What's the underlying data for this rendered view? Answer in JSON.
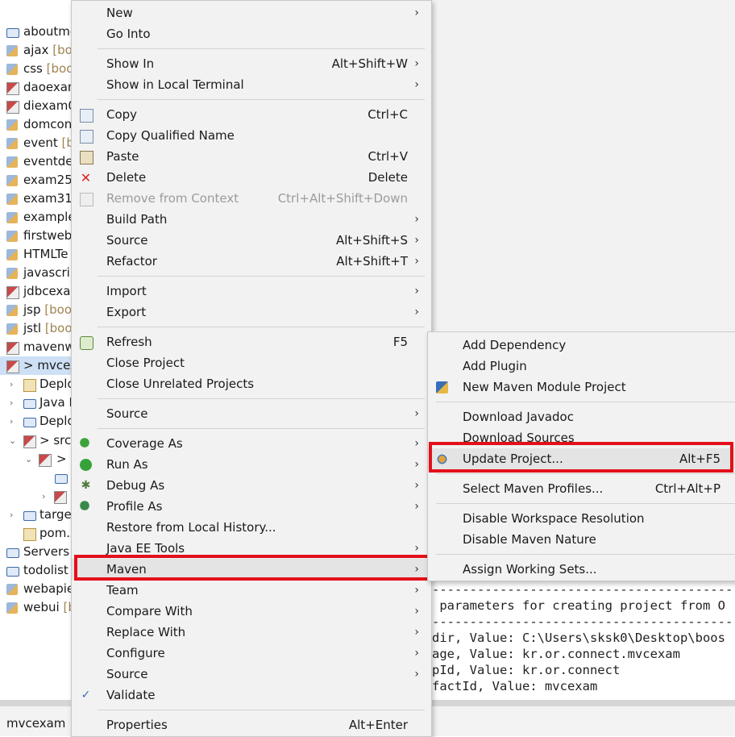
{
  "explorer": {
    "items": [
      {
        "label": "aboutme",
        "decoration": "",
        "icon": "folder-icon"
      },
      {
        "label": "ajax",
        "decoration": "[boo",
        "icon": "project-icon"
      },
      {
        "label": "css",
        "decoration": "[boo",
        "icon": "project-icon"
      },
      {
        "label": "daoexam",
        "decoration": "",
        "icon": "maven-project-icon"
      },
      {
        "label": "diexam0",
        "decoration": "",
        "icon": "maven-project-icon"
      },
      {
        "label": "domcon",
        "decoration": "",
        "icon": "project-icon"
      },
      {
        "label": "event",
        "decoration": "[bo",
        "icon": "project-icon"
      },
      {
        "label": "eventdel",
        "decoration": "",
        "icon": "project-icon"
      },
      {
        "label": "exam25",
        "decoration": "",
        "icon": "project-icon"
      },
      {
        "label": "exam31",
        "decoration": "",
        "icon": "project-icon"
      },
      {
        "label": "example",
        "decoration": "",
        "icon": "project-icon"
      },
      {
        "label": "firstweb",
        "decoration": "",
        "icon": "project-icon"
      },
      {
        "label": "HTMLTe",
        "decoration": "",
        "icon": "project-icon"
      },
      {
        "label": "javascrip",
        "decoration": "",
        "icon": "project-icon"
      },
      {
        "label": "jdbcexar",
        "decoration": "",
        "icon": "maven-project-icon"
      },
      {
        "label": "jsp",
        "decoration": "[boo",
        "icon": "project-icon"
      },
      {
        "label": "jstl",
        "decoration": "[boo",
        "icon": "project-icon"
      },
      {
        "label": "mavenw",
        "decoration": "",
        "icon": "maven-project-icon"
      },
      {
        "label": "> mvcex",
        "decoration": "",
        "icon": "maven-project-icon"
      },
      {
        "label": "Deplo",
        "decoration": "",
        "icon": "file-icon"
      },
      {
        "label": "Java F",
        "decoration": "",
        "icon": "folder-icon"
      },
      {
        "label": "Deplo",
        "decoration": "",
        "icon": "folder-icon"
      },
      {
        "label": "> src",
        "decoration": "",
        "icon": "folder-icon"
      },
      {
        "label": ">",
        "decoration": "",
        "icon": "folder-icon"
      },
      {
        "label": "",
        "decoration": "",
        "icon": "folder-icon"
      },
      {
        "label": "",
        "decoration": "",
        "icon": "folder-icon"
      },
      {
        "label": "target",
        "decoration": "",
        "icon": "folder-icon"
      },
      {
        "label": "pom.x",
        "decoration": "",
        "icon": "file-icon"
      },
      {
        "label": "Servers",
        "decoration": "",
        "icon": "folder-icon"
      },
      {
        "label": "todolist",
        "decoration": "",
        "icon": "folder-icon"
      },
      {
        "label": "webapie",
        "decoration": "",
        "icon": "project-icon"
      },
      {
        "label": "webui",
        "decoration": "[b",
        "icon": "project-icon"
      }
    ]
  },
  "status": {
    "label": "mvcexam"
  },
  "console": {
    "lines": [
      "------------------------------------------------",
      " parameters for creating project from O",
      "------------------------------------------------",
      "dir, Value: C:\\Users\\sksk0\\Desktop\\boos",
      "age, Value: kr.or.connect.mvcexam",
      "pId, Value: kr.or.connect",
      "factId, Value: mvcexam"
    ]
  },
  "context_menu": {
    "new": "New",
    "go_into": "Go Into",
    "show_in": "Show In",
    "show_in_acc": "Alt+Shift+W",
    "show_in_terminal": "Show in Local Terminal",
    "copy": "Copy",
    "copy_acc": "Ctrl+C",
    "copy_qualified": "Copy Qualified Name",
    "paste": "Paste",
    "paste_acc": "Ctrl+V",
    "delete": "Delete",
    "delete_acc": "Delete",
    "remove_context": "Remove from Context",
    "remove_context_acc": "Ctrl+Alt+Shift+Down",
    "build_path": "Build Path",
    "source1": "Source",
    "source1_acc": "Alt+Shift+S",
    "refactor": "Refactor",
    "refactor_acc": "Alt+Shift+T",
    "import": "Import",
    "export": "Export",
    "refresh": "Refresh",
    "refresh_acc": "F5",
    "close_project": "Close Project",
    "close_unrelated": "Close Unrelated Projects",
    "source2": "Source",
    "coverage_as": "Coverage As",
    "run_as": "Run As",
    "debug_as": "Debug As",
    "profile_as": "Profile As",
    "restore_history": "Restore from Local History...",
    "java_ee_tools": "Java EE Tools",
    "maven": "Maven",
    "team": "Team",
    "compare_with": "Compare With",
    "replace_with": "Replace With",
    "configure": "Configure",
    "source3": "Source",
    "validate": "Validate",
    "properties": "Properties",
    "properties_acc": "Alt+Enter"
  },
  "maven_menu": {
    "add_dependency": "Add Dependency",
    "add_plugin": "Add Plugin",
    "new_module": "New Maven Module Project",
    "download_javadoc": "Download Javadoc",
    "download_sources": "Download Sources",
    "update_project": "Update Project...",
    "update_project_acc": "Alt+F5",
    "select_profiles": "Select Maven Profiles...",
    "select_profiles_acc": "Ctrl+Alt+P",
    "disable_workspace": "Disable Workspace Resolution",
    "disable_nature": "Disable Maven Nature",
    "assign_sets": "Assign Working Sets..."
  },
  "colors": {
    "highlight_box": "#e3101a",
    "menu_bg": "#f2f2f2"
  }
}
